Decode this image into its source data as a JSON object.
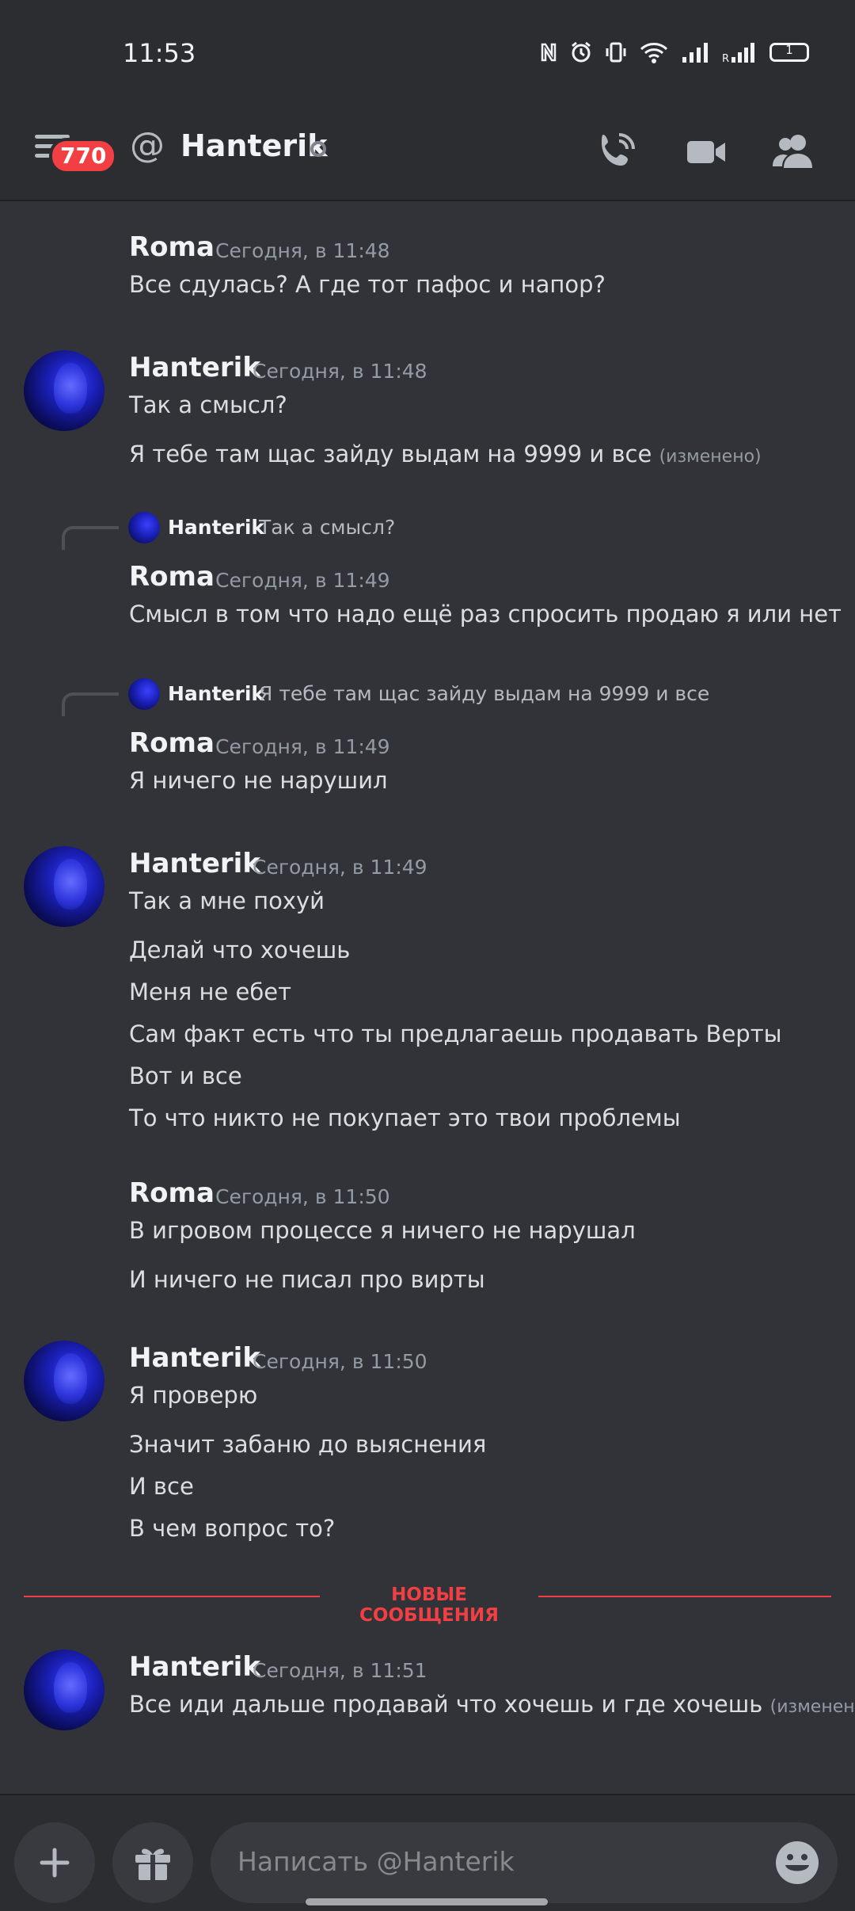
{
  "status_bar": {
    "time": "11:53",
    "battery": "1"
  },
  "header": {
    "unread_badge": "770",
    "at_symbol": "@",
    "title": "Hanterik"
  },
  "messages": [
    {
      "author": "Roma",
      "timestamp": "Сегодня, в 11:48",
      "lines": [
        "Все сдулась? А где тот пафос и напор?"
      ]
    },
    {
      "author": "Hanterik",
      "timestamp": "Сегодня, в 11:48",
      "lines": [
        "Так а смысл?",
        "Я тебе там щас зайду выдам на 9999 и все"
      ],
      "edited": "(изменено)"
    },
    {
      "author": "Roma",
      "timestamp": "Сегодня, в 11:49",
      "reply_to": {
        "author": "Hanterik",
        "text": "Так а смысл?"
      },
      "lines": [
        "Смысл в том что надо ещё раз спросить продаю я или нет"
      ]
    },
    {
      "author": "Roma",
      "timestamp": "Сегодня, в 11:49",
      "reply_to": {
        "author": "Hanterik",
        "text": "Я тебе там щас зайду выдам на 9999 и все"
      },
      "lines": [
        "Я ничего не нарушил"
      ]
    },
    {
      "author": "Hanterik",
      "timestamp": "Сегодня, в 11:49",
      "lines": [
        "Так а мне похуй",
        "Делай что хочешь",
        "Меня не ебет",
        "Сам факт есть что ты предлагаешь продавать Верты",
        "Вот и все",
        "То что никто не покупает это твои проблемы"
      ]
    },
    {
      "author": "Roma",
      "timestamp": "Сегодня, в 11:50",
      "lines": [
        "В игровом процессе я ничего не нарушал",
        "И ничего не писал про вирты"
      ]
    },
    {
      "author": "Hanterik",
      "timestamp": "Сегодня, в 11:50",
      "lines": [
        "Я проверю",
        "Значит забаню до выяснения",
        "И все",
        "В чем вопрос то?"
      ]
    },
    {
      "author": "Hanterik",
      "timestamp": "Сегодня, в 11:51",
      "lines": [
        "Все иди дальше продавай что хочешь и где хочешь"
      ],
      "edited": "(изменено)"
    }
  ],
  "new_messages_divider": "НОВЫЕ СООБЩЕНИЯ",
  "composer": {
    "placeholder": "Написать @Hanterik"
  },
  "colors": {
    "background": "#313338",
    "header": "#2b2d31",
    "accent_red": "#f23f43",
    "muted": "#949ba4"
  }
}
